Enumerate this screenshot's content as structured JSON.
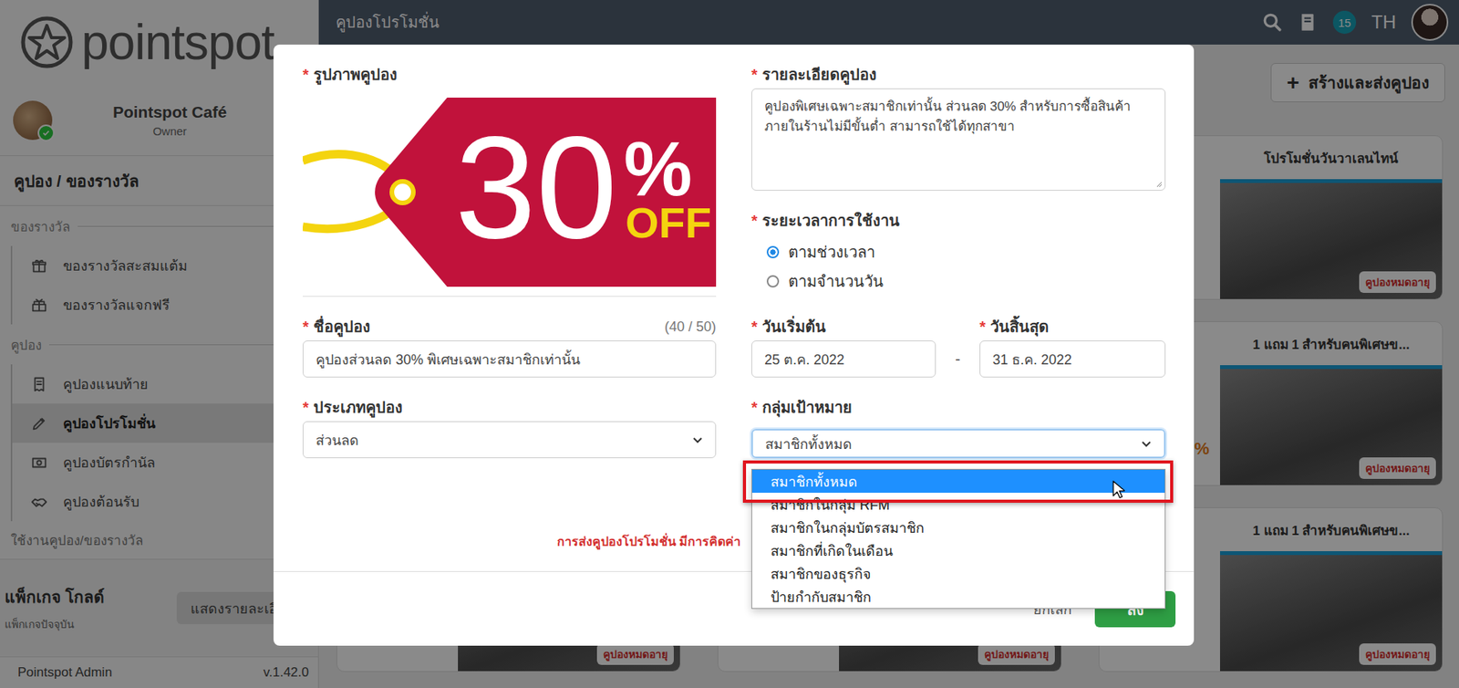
{
  "sidebar": {
    "logo": "pointspot",
    "profile": {
      "name": "Pointspot Café",
      "role": "Owner",
      "verified": true
    },
    "section_title": "คูปอง / ของรางวัล",
    "groups": [
      {
        "label": "ของรางวัล",
        "items": [
          {
            "label": "ของรางวัลสะสมแต้ม",
            "selected": false
          },
          {
            "label": "ของรางวัลแจกฟรี",
            "selected": false
          }
        ]
      },
      {
        "label": "คูปอง",
        "items": [
          {
            "label": "คูปองแนบท้าย",
            "selected": false
          },
          {
            "label": "คูปองโปรโมชั่น",
            "selected": true
          },
          {
            "label": "คูปองบัตรกำนัล",
            "selected": false
          },
          {
            "label": "คูปองต้อนรับ",
            "selected": false
          }
        ]
      }
    ],
    "usage_link": "ใช้งานคูปอง/ของรางวัล",
    "package": {
      "name": "แพ็กเกจ โกลด์",
      "caption": "แพ็กเกจปัจจุบัน",
      "button": "แสดงรายละเอี"
    },
    "footer": {
      "app": "Pointspot Admin",
      "version": "v.1.42.0"
    }
  },
  "topbar": {
    "title": "คูปองโปรโมชั่น",
    "notification_count": "15",
    "language": "TH"
  },
  "main": {
    "create_button": {
      "icon": "+",
      "label": "สร้างและส่งคูปอง"
    },
    "cards": [
      {},
      {},
      {
        "title": "โปรโมชั่นวันวาเลนไทน์",
        "badge": "คูปองหมดอายุ"
      },
      {},
      {},
      {
        "title": "1 แถม 1 สำหรับคนพิเศษข...",
        "badge": "คูปองหมดอายุ",
        "note": "%"
      },
      {
        "badge": "คูปองหมดอายุ"
      },
      {
        "badge": "คูปองหมดอายุ"
      },
      {
        "title": "1 แถม 1 สำหรับคนพิเศษข...",
        "badge": "คูปองหมดอายุ"
      }
    ]
  },
  "dialog": {
    "required_mark": "*",
    "image": {
      "label": "รูปภาพคูปอง",
      "required": true,
      "texts": [
        "30",
        "%",
        "OFF"
      ]
    },
    "name": {
      "label": "ชื่อคูปอง",
      "required": true,
      "counter": "(40 / 50)",
      "value": "คูปองส่วนลด 30% พิเศษเฉพาะสมาชิกเท่านั้น"
    },
    "type": {
      "label": "ประเภทคูปอง",
      "required": true,
      "value": "ส่วนลด"
    },
    "details": {
      "label": "รายละเอียดคูปอง",
      "required": true,
      "value": "คูปองพิเศษเฉพาะสมาชิกเท่านั้น ส่วนลด 30% สำหรับการซื้อสินค้าภายในร้านไม่มีขั้นต่ำ สามารถใช้ได้ทุกสาขา"
    },
    "period": {
      "label": "ระยะเวลาการใช้งาน",
      "required": true,
      "options": [
        {
          "label": "ตามช่วงเวลา",
          "selected": true
        },
        {
          "label": "ตามจำนวนวัน",
          "selected": false
        }
      ]
    },
    "start": {
      "label": "วันเริ่มต้น",
      "required": true,
      "value": "25 ต.ค. 2022"
    },
    "dash": "-",
    "end": {
      "label": "วันสิ้นสุด",
      "required": true,
      "value": "31 ธ.ค. 2022"
    },
    "target": {
      "label": "กลุ่มเป้าหมาย",
      "required": true,
      "value": "สมาชิกทั้งหมด",
      "expanded": true,
      "options": [
        {
          "label": "สมาชิกทั้งหมด",
          "selected": true,
          "annotated": true
        },
        {
          "label": "สมาชิกในกลุ่ม RFM",
          "selected": false,
          "annotated": false
        },
        {
          "label": "สมาชิกในกลุ่มบัตรสมาชิก",
          "selected": false,
          "annotated": false
        },
        {
          "label": "สมาชิกที่เกิดในเดือน",
          "selected": false,
          "annotated": false
        },
        {
          "label": "สมาชิกของธุรกิจ",
          "selected": false,
          "annotated": false
        },
        {
          "label": "ป้ายกำกับสมาชิก",
          "selected": false,
          "annotated": false
        }
      ]
    },
    "notice": "การส่งคูปองโปรโมชั่น มีการคิดค่า",
    "buttons": {
      "cancel": "ยกเลิก",
      "submit": "ส่ง"
    }
  }
}
